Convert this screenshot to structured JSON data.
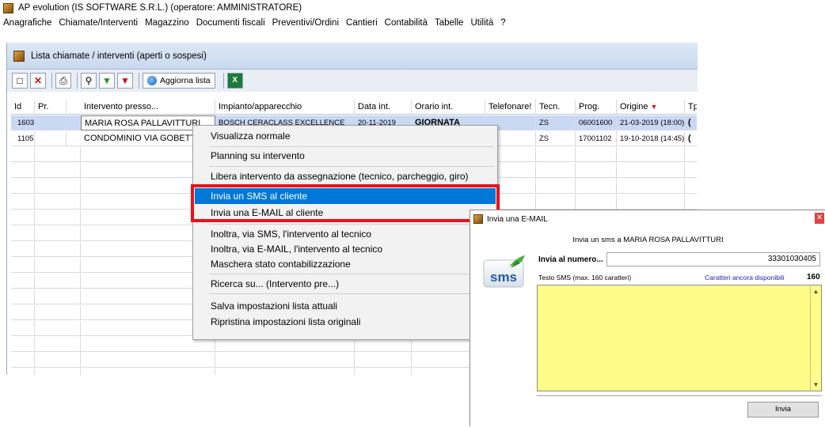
{
  "app": {
    "title": "AP evolution  (IS SOFTWARE S.R.L.) (operatore: AMMINISTRATORE)"
  },
  "menu": [
    "Anagrafiche",
    "Chiamate/Interventi",
    "Magazzino",
    "Documenti fiscali",
    "Preventivi/Ordini",
    "Cantieri",
    "Contabilità",
    "Tabelle",
    "Utilità",
    "?"
  ],
  "child_window": {
    "title": "Lista chiamate / interventi (aperti o sospesi)",
    "refresh_label": "Aggiorna lista"
  },
  "grid": {
    "headers": [
      "Id",
      "Pr.",
      "Intervento presso...",
      "Impianto/apparecchio",
      "Data int.",
      "Orario int.",
      "Telefonare!",
      "Tecn.",
      "Prog.",
      "Origine",
      "Tp."
    ],
    "rows": [
      {
        "id": "1603",
        "pr": "",
        "presso": "MARIA ROSA PALLAVITTURI",
        "impianto": "BOSCH CERACLASS EXCELLENCE",
        "data": "20-11-2019",
        "orario": "GIORNATA",
        "telefonare": "",
        "tecn": "ZS",
        "prog": "06001600",
        "origine": "21-03-2019 (18:00)",
        "tp": "("
      },
      {
        "id": "1105",
        "pr": "",
        "presso": "CONDOMINIO VIA GOBETT",
        "impianto": "",
        "data": "",
        "orario": "",
        "telefonare": "",
        "tecn": "ZS",
        "prog": "17001102",
        "origine": "19-10-2018 (14:45)",
        "tp": "("
      }
    ]
  },
  "context_menu": {
    "items": [
      "Visualizza normale",
      "Planning su intervento",
      "Libera intervento da assegnazione (tecnico, parcheggio, giro)",
      "Invia un SMS al cliente",
      "Invia una E-MAIL al cliente",
      "Inoltra, via SMS, l'intervento al tecnico",
      "Inoltra, via E-MAIL, l'intervento al tecnico",
      "Maschera stato contabilizzazione",
      "Ricerca su... (Intervento pre...)",
      "Salva impostazioni lista attuali",
      "Ripristina impostazioni lista originali"
    ],
    "highlighted_index": 3
  },
  "dialog": {
    "title": "Invia una E-MAIL",
    "subtitle": "Invia un sms a MARIA ROSA PALLAVITTURI",
    "logo_text": "sms",
    "number_label": "Invia al numero...",
    "number_value": "33301030405",
    "sms_label": "Testo SMS (max. 160 caratteri)",
    "remaining_label": "Caratteri ancora disponibili",
    "remaining_value": "160",
    "send_label": "Invia"
  },
  "colors": {
    "menu_highlight": "#0078d7",
    "red_frame": "#e3141d",
    "sms_area": "#fdfd87",
    "title_gradient": "#c9d9ee"
  }
}
